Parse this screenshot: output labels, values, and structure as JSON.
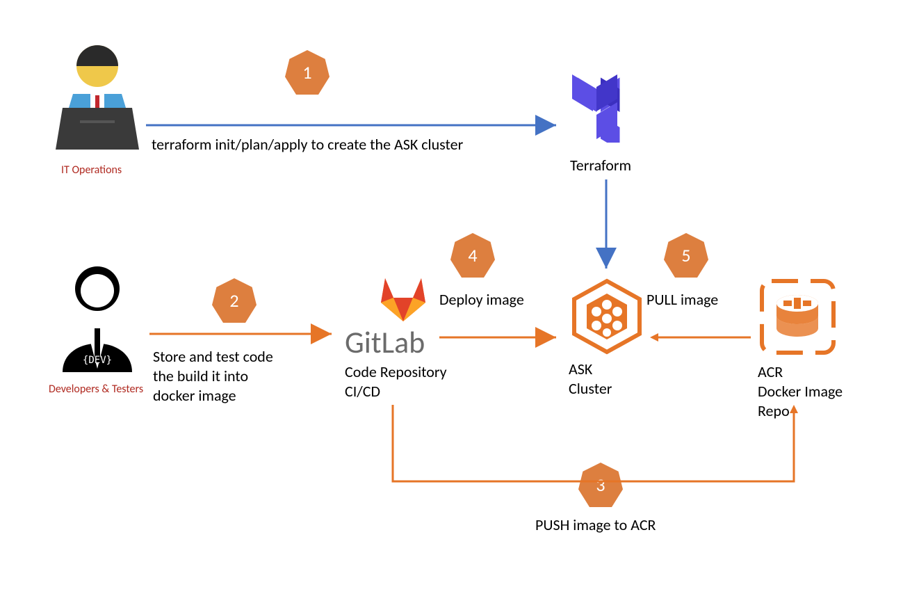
{
  "roles": {
    "it_ops": "IT Operations",
    "devtest": "Developers & Testers"
  },
  "nodes": {
    "terraform": "Terraform",
    "gitlab_name": "GitLab",
    "gitlab_sub1": "Code Repository",
    "gitlab_sub2": "CI/CD",
    "ask1": "ASK",
    "ask2": "Cluster",
    "acr1": "ACR",
    "acr2": "Docker Image",
    "acr3": "Repo"
  },
  "steps": {
    "s1": "1",
    "s2": "2",
    "s3": "3",
    "s4": "4",
    "s5": "5"
  },
  "arrows": {
    "a1": "terraform init/plan/apply to create the ASK cluster",
    "a2a": "Store and test code",
    "a2b": "the build it into",
    "a2c": "docker image",
    "a3": "PUSH image to ACR",
    "a4": "Deploy image",
    "a5": "PULL image"
  },
  "colors": {
    "orange": "#e67527",
    "heptagon": "#dd7f3f",
    "blue_arrow": "#4472c4",
    "terraform_purple": "#5c4ee5",
    "role_red": "#b02a21",
    "gitlab_gray": "#6b6b6b"
  }
}
